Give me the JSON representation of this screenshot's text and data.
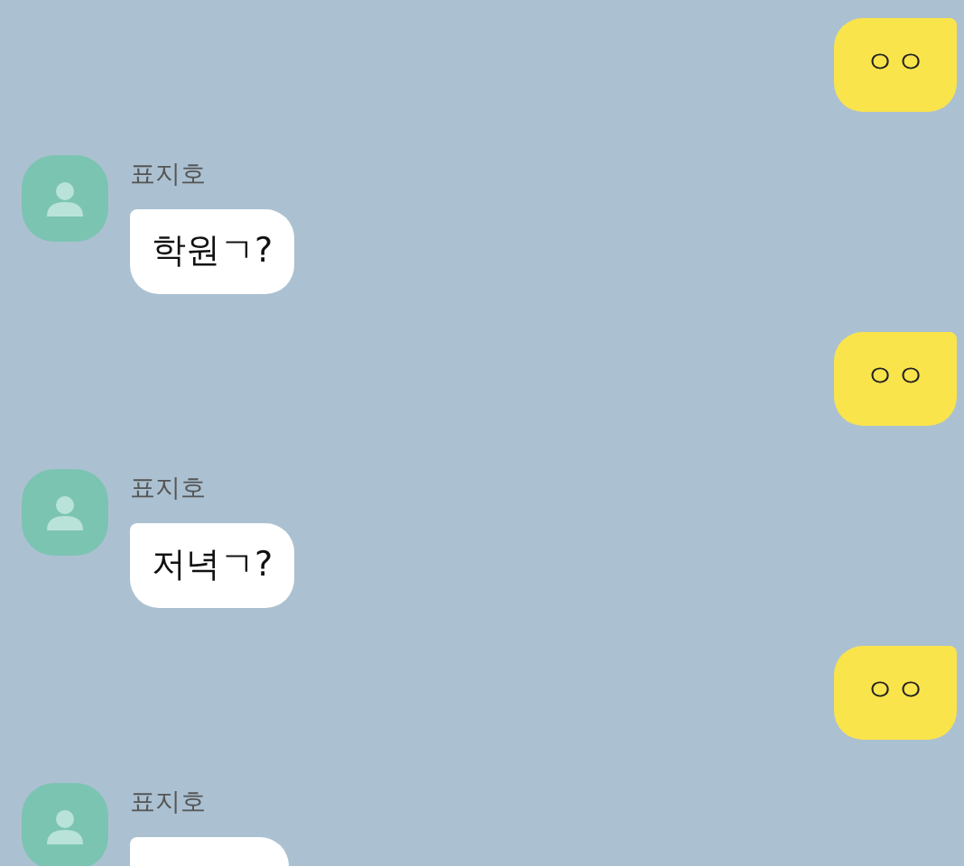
{
  "messages": [
    {
      "kind": "sent",
      "text": "ㅇㅇ"
    },
    {
      "kind": "received",
      "sender": "표지호",
      "text": "학원ㄱ?"
    },
    {
      "kind": "sent",
      "text": "ㅇㅇ"
    },
    {
      "kind": "received",
      "sender": "표지호",
      "text": "저녁ㄱ?"
    },
    {
      "kind": "sent",
      "text": "ㅇㅇ"
    },
    {
      "kind": "received",
      "sender": "표지호"
    }
  ]
}
